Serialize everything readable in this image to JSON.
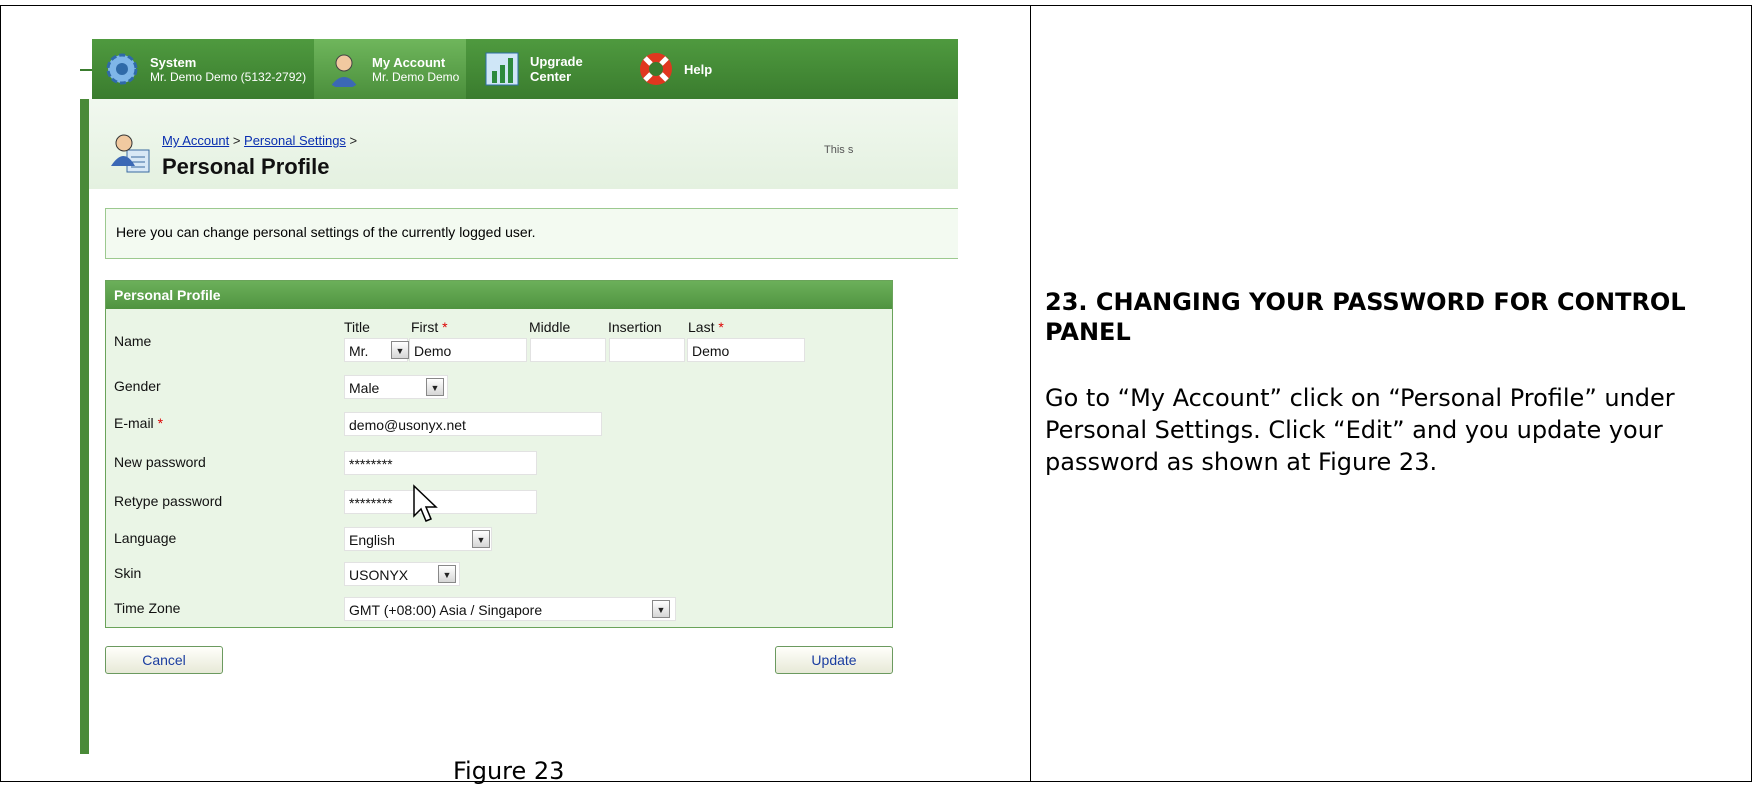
{
  "tabs": [
    {
      "title": "System",
      "subtitle": "Mr. Demo Demo (5132-2792)"
    },
    {
      "title": "My Account",
      "subtitle": "Mr. Demo Demo"
    },
    {
      "title": "Upgrade Center",
      "subtitle": ""
    },
    {
      "title": "Help",
      "subtitle": ""
    }
  ],
  "breadcrumb": {
    "item1": "My Account",
    "sep1": " > ",
    "item2": "Personal Settings",
    "sep2": " >"
  },
  "page_title": "Personal Profile",
  "header_note": "This s",
  "intro_text": "Here you can change personal settings of the currently logged user.",
  "panel": {
    "title": "Personal Profile",
    "name": {
      "label": "Name",
      "col_title": "Title",
      "col_first": "First",
      "col_middle": "Middle",
      "col_insertion": "Insertion",
      "col_last": "Last",
      "title_value": "Mr.",
      "first_value": "Demo",
      "middle_value": "",
      "insertion_value": "",
      "last_value": "Demo"
    },
    "gender": {
      "label": "Gender",
      "value": "Male"
    },
    "email": {
      "label": "E-mail",
      "value": "demo@usonyx.net"
    },
    "new_password": {
      "label": "New password",
      "value": "********"
    },
    "retype_password": {
      "label": "Retype password",
      "value": "********"
    },
    "language": {
      "label": "Language",
      "value": "English"
    },
    "skin": {
      "label": "Skin",
      "value": "USONYX"
    },
    "timezone": {
      "label": "Time Zone",
      "value": "GMT (+08:00) Asia / Singapore"
    },
    "required_mark": "*"
  },
  "buttons": {
    "cancel": "Cancel",
    "update": "Update"
  },
  "figure_caption": "Figure 23",
  "section": {
    "title": "23. CHANGING YOUR PASSWORD FOR CONTROL PANEL",
    "body": "Go to “My Account” click on “Personal Profile” under Personal Settings. Click “Edit” and you update your password as shown at Figure 23."
  },
  "colors": {
    "brand_green": "#4a8e3b",
    "panel_bg": "#eaf5e6",
    "required": "#dd0000",
    "link": "#0a2fb0"
  },
  "icons": [
    "gear-icon",
    "user-icon",
    "chart-icon",
    "lifebuoy-icon",
    "profile-icon",
    "dropdown-arrow-icon",
    "mouse-cursor-icon"
  ]
}
